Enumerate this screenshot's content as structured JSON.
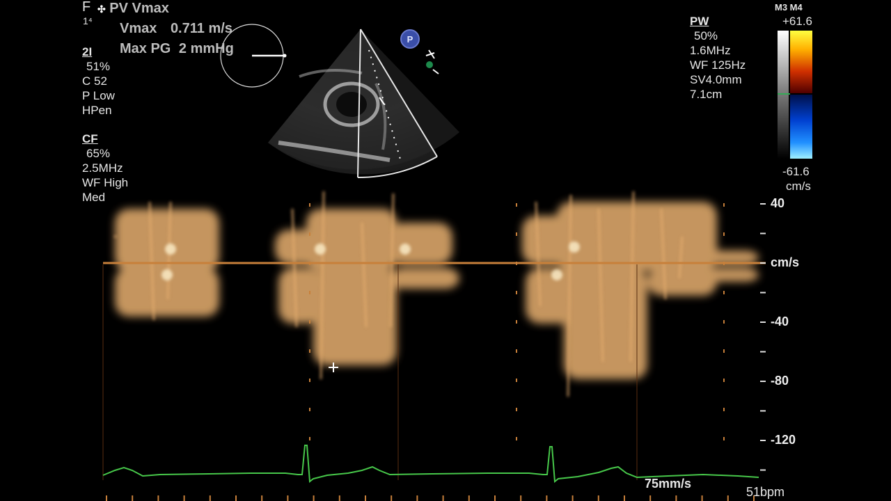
{
  "left_panel": {
    "top_letter": "F",
    "top_sub": "1⁴",
    "section_2d": {
      "header": "2I",
      "lines": [
        "51%",
        "C 52",
        "P Low",
        "HPen"
      ]
    },
    "section_cf": {
      "header": "CF",
      "lines": [
        "65%",
        "2.5MHz",
        "WF High",
        "Med"
      ]
    }
  },
  "measurement": {
    "title": "PV Vmax",
    "rows": [
      {
        "label": "Vmax",
        "value": "0.711 m/s"
      },
      {
        "label": "Max PG",
        "value": "2 mmHg"
      }
    ]
  },
  "pw_panel": {
    "header": "PW",
    "lines": [
      "50%",
      "1.6MHz",
      "WF 125Hz",
      "SV4.0mm",
      "7.1cm"
    ]
  },
  "color_bar": {
    "mode": "M3 M4",
    "top_value": "+61.6",
    "bottom_value": "-61.6",
    "unit": "cm/s"
  },
  "velocity_scale": {
    "unit": "cm/s",
    "ticks": [
      "40",
      "-40",
      "-80",
      "-120"
    ]
  },
  "footer": {
    "sweep_speed": "75mm/s",
    "heart_rate": "51bpm"
  },
  "probe_marker": "P",
  "colors": {
    "doppler": "#e8b070",
    "baseline": "#c8803a",
    "ecg": "#47c84a",
    "cursor": "#ffffff"
  }
}
